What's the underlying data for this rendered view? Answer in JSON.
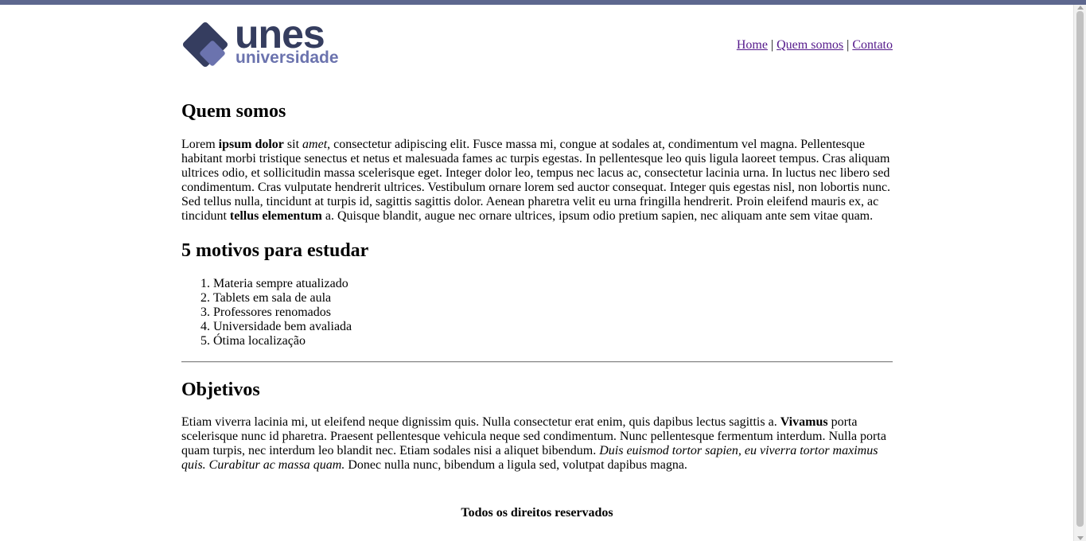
{
  "header": {
    "logo": {
      "brand": "unes",
      "subtitle": "universidade",
      "colors": {
        "dark": "#353d5f",
        "light": "#6b73ae"
      }
    },
    "nav": {
      "home": "Home",
      "quem_somos": "Quem somos",
      "contato": "Contato",
      "separator": "|"
    }
  },
  "quem_somos": {
    "title": "Quem somos",
    "p1_lorem": "Lorem ",
    "p1_ipsum": "ipsum dolor",
    "p1_sit": " sit ",
    "p1_amet": "amet",
    "p1_body": ", consectetur adipiscing elit. Fusce massa mi, congue at sodales at, condimentum vel magna. Pellentesque habitant morbi tristique senectus et netus et malesuada fames ac turpis egestas. In pellentesque leo quis ligula laoreet tempus. Cras aliquam ultrices odio, et sollicitudin massa scelerisque eget. Integer dolor leo, tempus nec lacus ac, consectetur lacinia urna. In luctus nec libero sed condimentum. Cras vulputate hendrerit ultrices. Vestibulum ornare lorem sed auctor consequat. Integer quis egestas nisl, non lobortis nunc. Sed tellus nulla, tincidunt at turpis id, sagittis sagittis dolor. Aenean pharetra velit eu urna fringilla hendrerit. Proin eleifend mauris ex, ac tincidunt ",
    "p1_tellus": "tellus elementum",
    "p1_end": " a. Quisque blandit, augue nec ornare ultrices, ipsum odio pretium sapien, nec aliquam ante sem vitae quam."
  },
  "motivos": {
    "title": "5 motivos para estudar",
    "items": [
      "Materia sempre atualizado",
      "Tablets em sala de aula",
      "Professores renomados",
      "Universidade bem avaliada",
      "Ótima localização"
    ]
  },
  "objetivos": {
    "title": "Objetivos",
    "p_start": "Etiam viverra lacinia mi, ut eleifend neque dignissim quis. Nulla consectetur erat enim, quis dapibus lectus sagittis a. ",
    "p_vivamus": "Vivamus",
    "p_mid": " porta scelerisque nunc id pharetra. Praesent pellentesque vehicula neque sed condimentum. Nunc pellentesque fermentum interdum. Nulla porta quam turpis, nec interdum leo blandit nec. Etiam sodales nisi a aliquet bibendum. ",
    "p_italic": "Duis euismod tortor sapien, eu viverra tortor maximus quis. Curabitur ac massa quam.",
    "p_end": " Donec nulla nunc, bibendum a ligula sed, volutpat dapibus magna."
  },
  "footer": {
    "text": "Todos os direitos reservados"
  }
}
